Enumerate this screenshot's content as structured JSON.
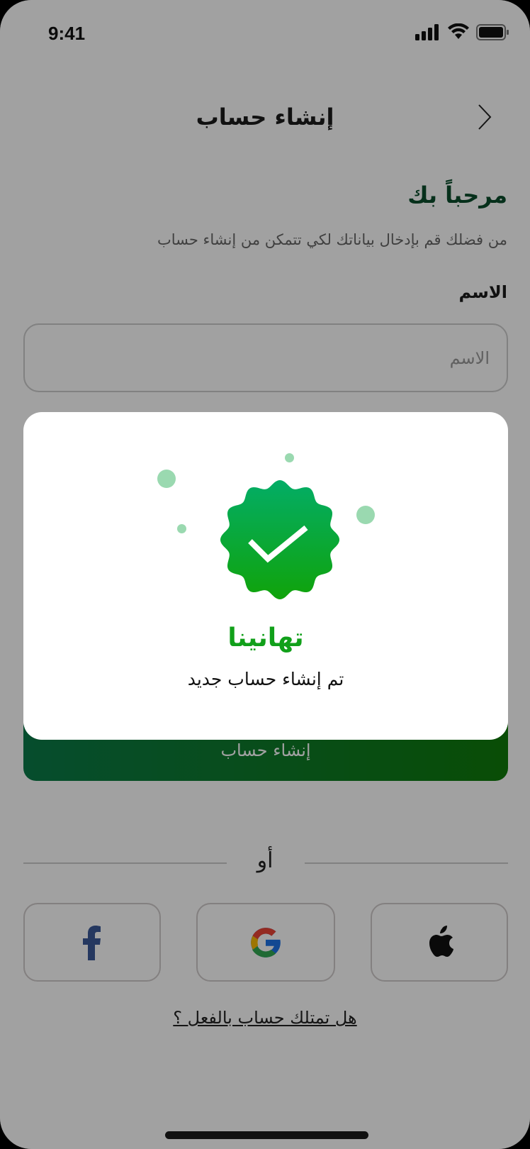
{
  "status_bar": {
    "time": "9:41"
  },
  "header": {
    "title": "إنشاء حساب"
  },
  "form": {
    "welcome": "مرحباً بك",
    "subtitle": "من فضلك قم بإدخال بياناتك لكي تتمكن من إنشاء حساب",
    "name_label": "الاسم",
    "name_placeholder": "الاسم",
    "name_value": "",
    "submit_label": "إنشاء حساب"
  },
  "social": {
    "or_label": "أو",
    "providers": [
      "facebook",
      "google",
      "apple"
    ]
  },
  "login_link": "هل تمتلك حساب بالفعل ؟",
  "modal": {
    "title": "تهانينا",
    "message": "تم إنشاء حساب جديد"
  },
  "colors": {
    "brand_green": "#11a01a",
    "dark_green": "#0a4d2c",
    "fb_blue": "#3b5998"
  }
}
